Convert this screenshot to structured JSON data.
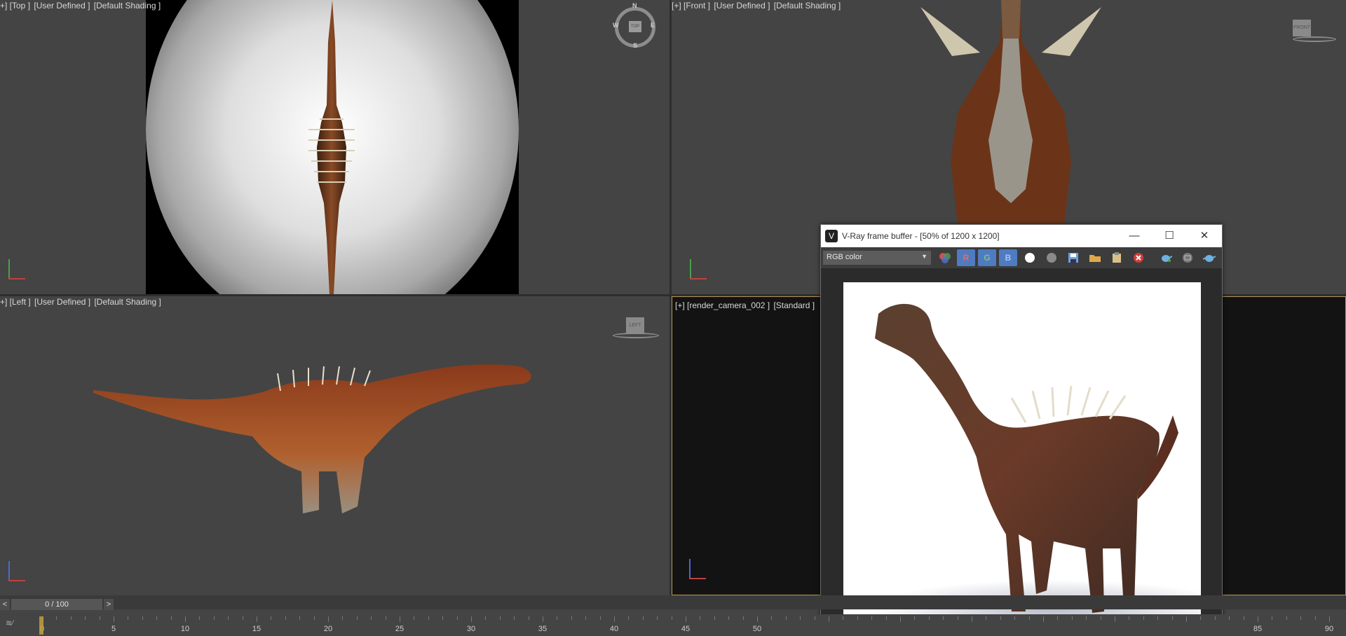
{
  "viewports": {
    "top": {
      "labels": [
        "+] [Top ]",
        "[User Defined ]",
        "[Default Shading ]"
      ]
    },
    "front": {
      "labels": [
        "[+] [Front ]",
        "[User Defined ]",
        "[Default Shading ]"
      ]
    },
    "left": {
      "labels": [
        "+] [Left ]",
        "[User Defined ]",
        "[Default Shading ]"
      ]
    },
    "camera": {
      "labels": [
        "[+] [render_camera_002 ]",
        "[Standard ]"
      ]
    }
  },
  "compass": {
    "n": "N",
    "s": "S",
    "e": "E",
    "w": "W",
    "cube": "TOP"
  },
  "viewcube": {
    "front": "FRONT",
    "left": "LEFT"
  },
  "vfb": {
    "title": "V-Ray frame buffer - [50% of 1200 x 1200]",
    "channel": "RGB color",
    "r": "R",
    "g": "G",
    "b": "B",
    "minimize": "—",
    "maximize": "☐",
    "close": "✕"
  },
  "frame_counter": {
    "value": "0 / 100",
    "prev": "<",
    "next": ">"
  },
  "timeline": {
    "labels": [
      "0",
      "5",
      "10",
      "15",
      "20",
      "25",
      "30",
      "35",
      "40",
      "45",
      "50",
      "85",
      "90"
    ]
  },
  "colors": {
    "viewport_bg": "#444444",
    "camera_border": "#b8975a",
    "channel_btn": "#4f7bc0"
  }
}
